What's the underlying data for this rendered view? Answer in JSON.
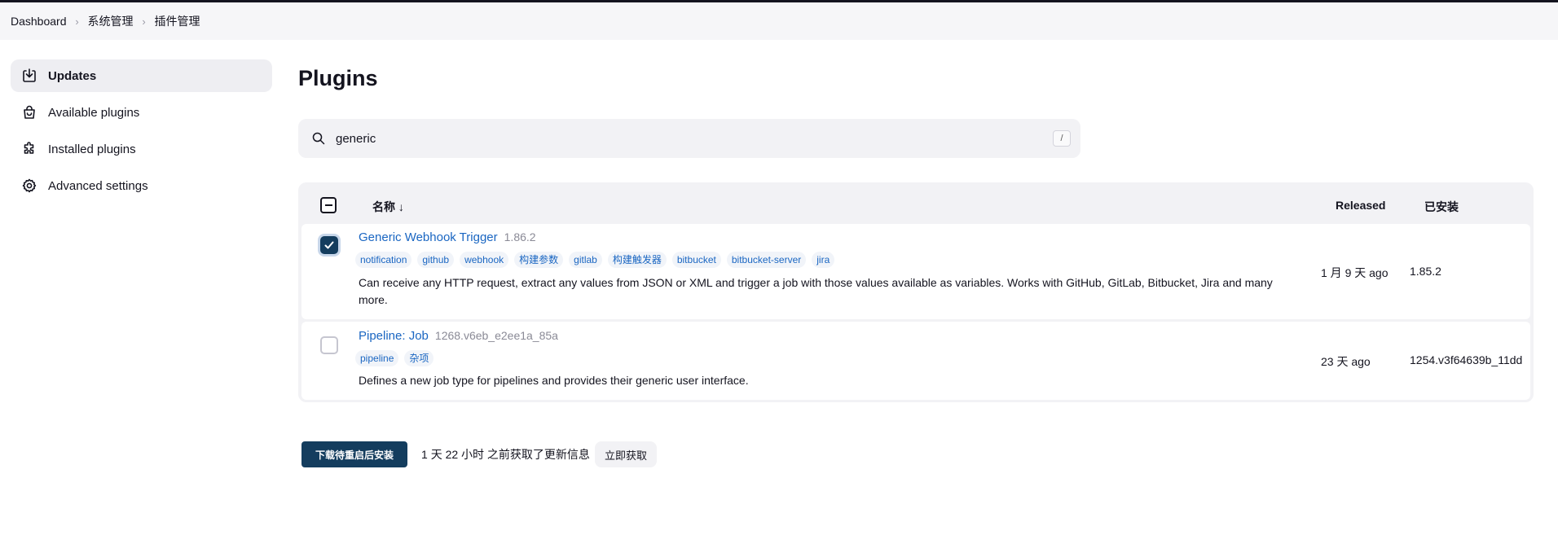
{
  "breadcrumb": {
    "items": [
      "Dashboard",
      "系统管理",
      "插件管理"
    ]
  },
  "sidebar": {
    "items": [
      {
        "label": "Updates",
        "icon": "download-icon",
        "active": true
      },
      {
        "label": "Available plugins",
        "icon": "shopping-bag-icon",
        "active": false
      },
      {
        "label": "Installed plugins",
        "icon": "puzzle-icon",
        "active": false
      },
      {
        "label": "Advanced settings",
        "icon": "gear-icon",
        "active": false
      }
    ]
  },
  "main": {
    "title": "Plugins",
    "search": {
      "value": "generic",
      "shortcut": "/"
    },
    "table": {
      "headers": {
        "name": "名称 ↓",
        "released": "Released",
        "installed": "已安装"
      },
      "rows": [
        {
          "name": "Generic Webhook Trigger",
          "version": "1.86.2",
          "checked": true,
          "tags": [
            "notification",
            "github",
            "webhook",
            "构建参数",
            "gitlab",
            "构建触发器",
            "bitbucket",
            "bitbucket-server",
            "jira"
          ],
          "description": "Can receive any HTTP request, extract any values from JSON or XML and trigger a job with those values available as variables. Works with GitHub, GitLab, Bitbucket, Jira and many more.",
          "released": "1 月 9 天 ago",
          "installed": "1.85.2"
        },
        {
          "name": "Pipeline: Job",
          "version": "1268.v6eb_e2ee1a_85a",
          "checked": false,
          "tags": [
            "pipeline",
            "杂项"
          ],
          "description": "Defines a new job type for pipelines and provides their generic user interface.",
          "released": "23 天 ago",
          "installed": "1254.v3f64639b_11dd"
        }
      ]
    },
    "actions": {
      "install_label": "下载待重启后安装",
      "status": "1 天 22 小时 之前获取了更新信息",
      "fetch_label": "立即获取"
    }
  },
  "colors": {
    "accent": "#143d5e",
    "link": "#1a66c2",
    "surface": "#f2f2f5"
  }
}
